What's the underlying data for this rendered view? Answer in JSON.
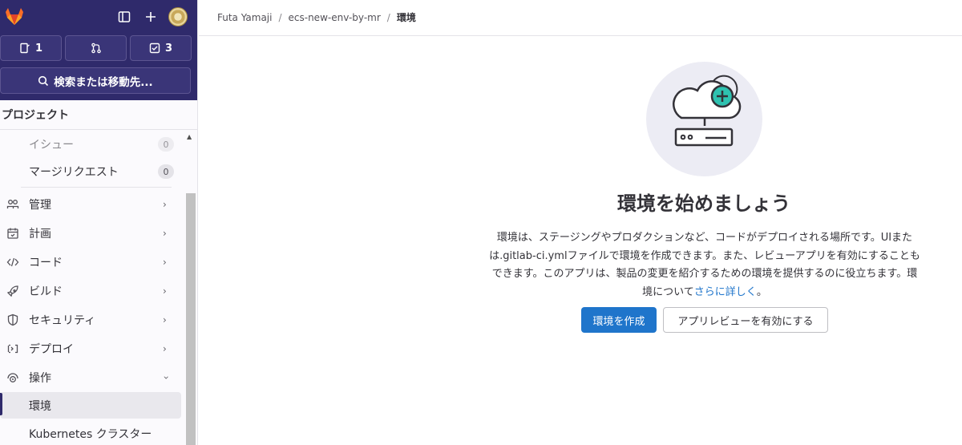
{
  "sidebar": {
    "counters": [
      {
        "icon": "issues-icon",
        "count": "1"
      },
      {
        "icon": "merge-request-icon",
        "count": ""
      },
      {
        "icon": "todo-icon",
        "count": "3"
      }
    ],
    "search_label": "検索または移動先...",
    "section_title": "プロジェクト",
    "sub_items": [
      {
        "label": "イシュー",
        "badge": "0"
      },
      {
        "label": "マージリクエスト",
        "badge": "0"
      }
    ],
    "items": [
      {
        "icon": "users-icon",
        "label": "管理"
      },
      {
        "icon": "calendar-icon",
        "label": "計画"
      },
      {
        "icon": "code-icon",
        "label": "コード"
      },
      {
        "icon": "rocket-icon",
        "label": "ビルド"
      },
      {
        "icon": "shield-icon",
        "label": "セキュリティ"
      },
      {
        "icon": "deploy-icon",
        "label": "デプロイ"
      },
      {
        "icon": "monitor-icon",
        "label": "操作"
      }
    ],
    "operate_children": [
      {
        "label": "環境"
      },
      {
        "label": "Kubernetes クラスター"
      }
    ]
  },
  "breadcrumb": {
    "items": [
      "Futa Yamaji",
      "ecs-new-env-by-mr",
      "環境"
    ]
  },
  "empty_state": {
    "title": "環境を始めましょう",
    "description": "環境は、ステージングやプロダクションなど、コードがデプロイされる場所です。UIまたは.gitlab-ci.ymlファイルで環境を作成できます。また、レビューアプリを有効にすることもできます。このアプリは、製品の変更を紹介するための環境を提供するのに役立ちます。環境について",
    "link_text": "さらに詳しく",
    "trailing": "。",
    "primary_button": "環境を作成",
    "secondary_button": "アプリレビューを有効にする"
  },
  "colors": {
    "sidebar_top": "#2f2a6b",
    "primary": "#1f75cb",
    "accent_teal": "#2ec2b0"
  }
}
